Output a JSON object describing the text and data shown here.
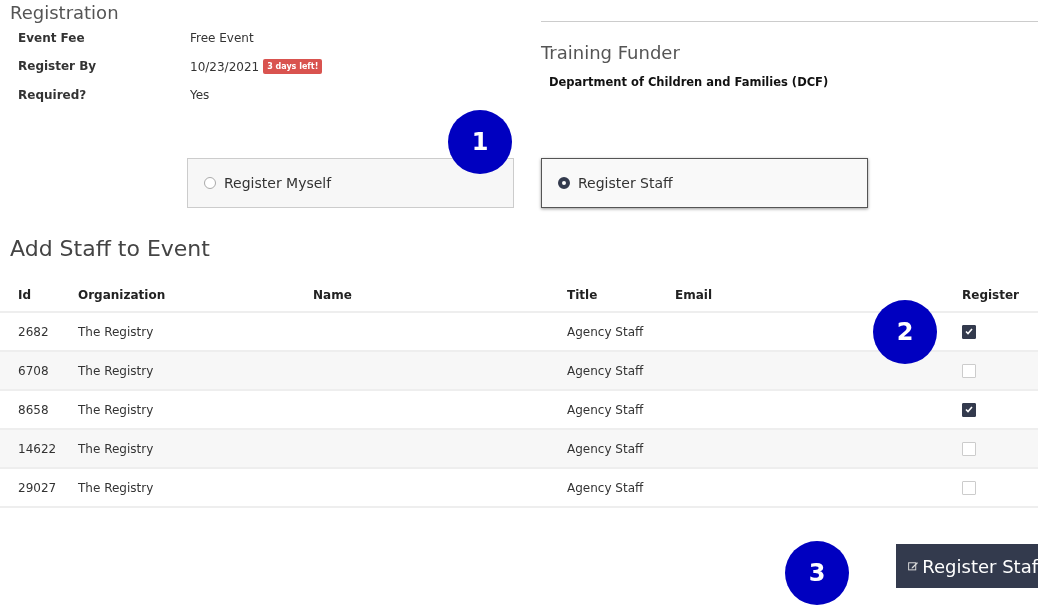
{
  "registration": {
    "title": "Registration",
    "fields": [
      {
        "label": "Event Fee",
        "value": "Free Event"
      },
      {
        "label": "Register By",
        "value": "10/23/2021",
        "badge": "3 days left!"
      },
      {
        "label": "Required?",
        "value": "Yes"
      }
    ]
  },
  "funder": {
    "title": "Training Funder",
    "name": "Department of Children and Families (DCF)"
  },
  "register_options": [
    {
      "label": "Register Myself",
      "selected": false
    },
    {
      "label": "Register Staff",
      "selected": true
    }
  ],
  "staff": {
    "title": "Add Staff to Event",
    "columns": [
      "Id",
      "Organization",
      "Name",
      "Title",
      "Email",
      "Register"
    ],
    "rows": [
      {
        "id": "2682",
        "organization": "The Registry",
        "title": "Agency Staff",
        "checked": true
      },
      {
        "id": "6708",
        "organization": "The Registry",
        "title": "Agency Staff",
        "checked": false
      },
      {
        "id": "8658",
        "organization": "The Registry",
        "title": "Agency Staff",
        "checked": true
      },
      {
        "id": "14622",
        "organization": "The Registry",
        "title": "Agency Staff",
        "checked": false
      },
      {
        "id": "29027",
        "organization": "The Registry",
        "title": "Agency Staff",
        "checked": false
      }
    ]
  },
  "submit_button": {
    "label": "Register Staf"
  },
  "annotations": [
    {
      "number": "1"
    },
    {
      "number": "2"
    },
    {
      "number": "3"
    }
  ]
}
